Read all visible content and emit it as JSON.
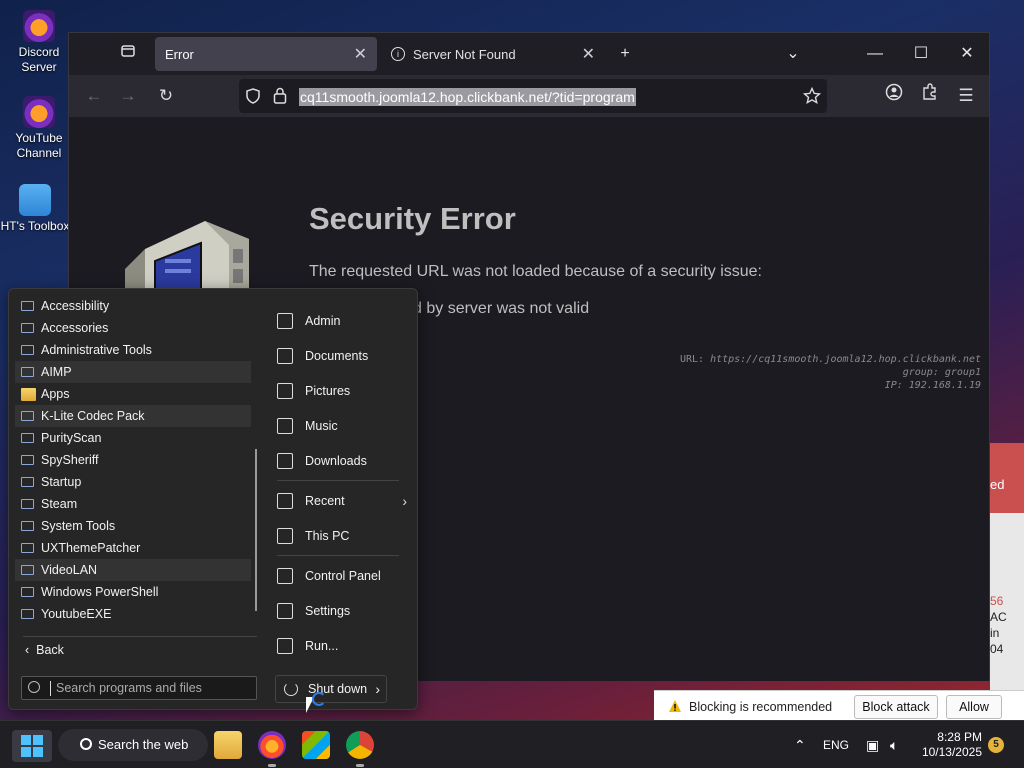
{
  "desktop": {
    "icons": [
      {
        "label": "Discord Server"
      },
      {
        "label": "YouTube Channel"
      },
      {
        "label": "HT's Toolbox"
      }
    ]
  },
  "browser": {
    "tabs": [
      {
        "label": "Error"
      },
      {
        "label": "Server Not Found"
      }
    ],
    "url": "cq11smooth.joomla12.hop.clickbank.net/?tid=program",
    "page": {
      "title": "Security Error",
      "description": "The requested URL was not loaded because of a security issue:",
      "detail": "lied by server was not valid",
      "meta_url_label": "URL:",
      "meta_url": "https://cq11smooth.joomla12.hop.clickbank.net",
      "meta_group": "group: group1",
      "meta_ip": "IP: 192.168.1.19"
    }
  },
  "alert": {
    "partial_header": "ed",
    "partial_lines": [
      "56",
      "AC",
      "in",
      "04"
    ],
    "message": "Blocking is recommended",
    "block_label": "Block attack",
    "allow_label": "Allow"
  },
  "start_menu": {
    "programs": [
      "Accessibility",
      "Accessories",
      "Administrative Tools",
      "AIMP",
      "Apps",
      "K-Lite Codec Pack",
      "PurityScan",
      "SpySheriff",
      "Startup",
      "Steam",
      "System Tools",
      "UXThemePatcher",
      "VideoLAN",
      "Windows PowerShell",
      "YoutubeEXE"
    ],
    "back_label": "Back",
    "search_placeholder": "Search programs and files",
    "right_items": [
      {
        "label": "Admin",
        "icon": "user-folder-icon"
      },
      {
        "label": "Documents",
        "icon": "document-icon"
      },
      {
        "label": "Pictures",
        "icon": "picture-icon"
      },
      {
        "label": "Music",
        "icon": "music-icon"
      },
      {
        "label": "Downloads",
        "icon": "download-icon"
      },
      {
        "label": "Recent",
        "icon": "clock-icon"
      },
      {
        "label": "This PC",
        "icon": "computer-icon"
      },
      {
        "label": "Control Panel",
        "icon": "control-panel-icon"
      },
      {
        "label": "Settings",
        "icon": "gear-icon"
      },
      {
        "label": "Run...",
        "icon": "run-icon"
      }
    ],
    "shutdown_label": "Shut down"
  },
  "taskbar": {
    "search_label": "Search the web",
    "lang": "ENG",
    "time": "8:28 PM",
    "date": "10/13/2025",
    "notification_count": "5"
  },
  "colors": {
    "accent": "#4cc2ff",
    "alert_red": "#c9504f",
    "browser_bg": "#1c1b22"
  }
}
